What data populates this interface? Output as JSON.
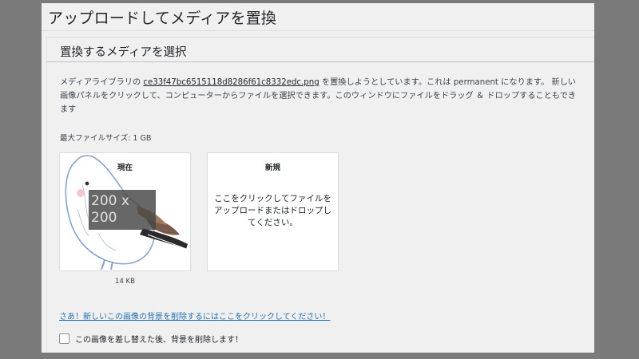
{
  "page": {
    "title": "アップロードしてメディアを置換",
    "section_title": "置換するメディアを選択"
  },
  "description": {
    "prefix": "メディアライブラリの ",
    "filename": "ce33f47bc6515118d8286f61c8332edc.png",
    "middle": " を置換しようとしています。これは ",
    "mode": "permanent",
    "suffix": " になります。 新しい画像パネルをクリックして、コンピューターからファイルを選択できます。このウィンドウにファイルをドラッグ ＆ ドロップすることもできます"
  },
  "max_file_size": "最大ファイルサイズ: 1 GB",
  "current": {
    "label": "現在",
    "placeholder_line1": "200 x",
    "placeholder_line2": "200",
    "file_size": "14 KB"
  },
  "new": {
    "label": "新規",
    "drop_text_1": "ここをクリックしてファイルを",
    "drop_text_2": "アップロードまたはドロップし",
    "drop_text_3": "てください。"
  },
  "remove_bg_link": "さあ！新しいこの画像の背景を削除するにはここをクリックしてください！",
  "remove_bg_checkbox": {
    "label": "この画像を差し替えた後、背景を削除します！",
    "checked": false
  }
}
